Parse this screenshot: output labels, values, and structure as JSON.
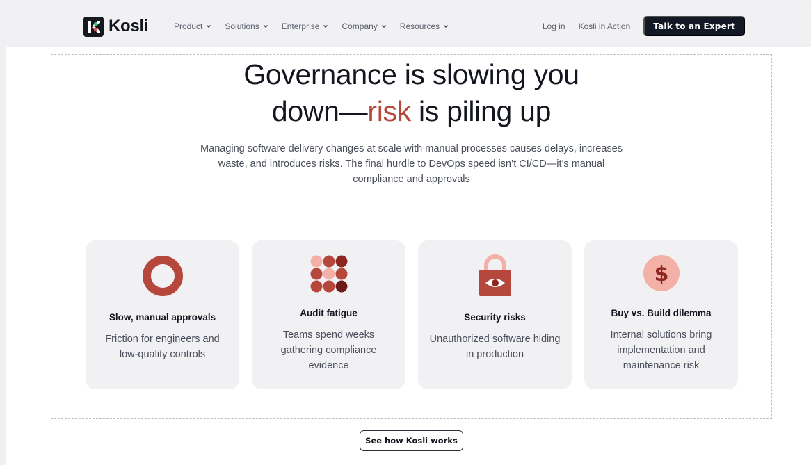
{
  "brand": {
    "name": "Kosli"
  },
  "nav": {
    "items": [
      {
        "label": "Product"
      },
      {
        "label": "Solutions"
      },
      {
        "label": "Enterprise"
      },
      {
        "label": "Company"
      },
      {
        "label": "Resources"
      }
    ],
    "login": "Log in",
    "in_action": "Kosli in Action",
    "cta": "Talk to an Expert"
  },
  "hero": {
    "line1": "Governance is slowing you",
    "line2_pre": "down—",
    "line2_accent": "risk",
    "line2_post": " is piling up",
    "description": "Managing software delivery changes at scale with manual processes causes delays, increases waste, and introduces risks. The final hurdle to DevOps speed isn’t CI/CD—it’s manual compliance and approvals"
  },
  "cards": [
    {
      "icon": "ring-icon",
      "title": "Slow, manual approvals",
      "description": "Friction for engineers and low-quality controls"
    },
    {
      "icon": "dot-grid-icon",
      "title": "Audit fatigue",
      "description": "Teams spend weeks gathering compliance evidence"
    },
    {
      "icon": "padlock-eye-icon",
      "title": "Security risks",
      "description": "Unauthorized software hiding in production"
    },
    {
      "icon": "dollar-coin-icon",
      "title": "Buy vs. Build dilemma",
      "description": "Internal solutions bring implementation and maintenance risk"
    }
  ],
  "footer_cta": "See how Kosli works",
  "colors": {
    "accent": "#b5473d",
    "dark": "#131924",
    "card_bg": "#f1f1f4"
  }
}
